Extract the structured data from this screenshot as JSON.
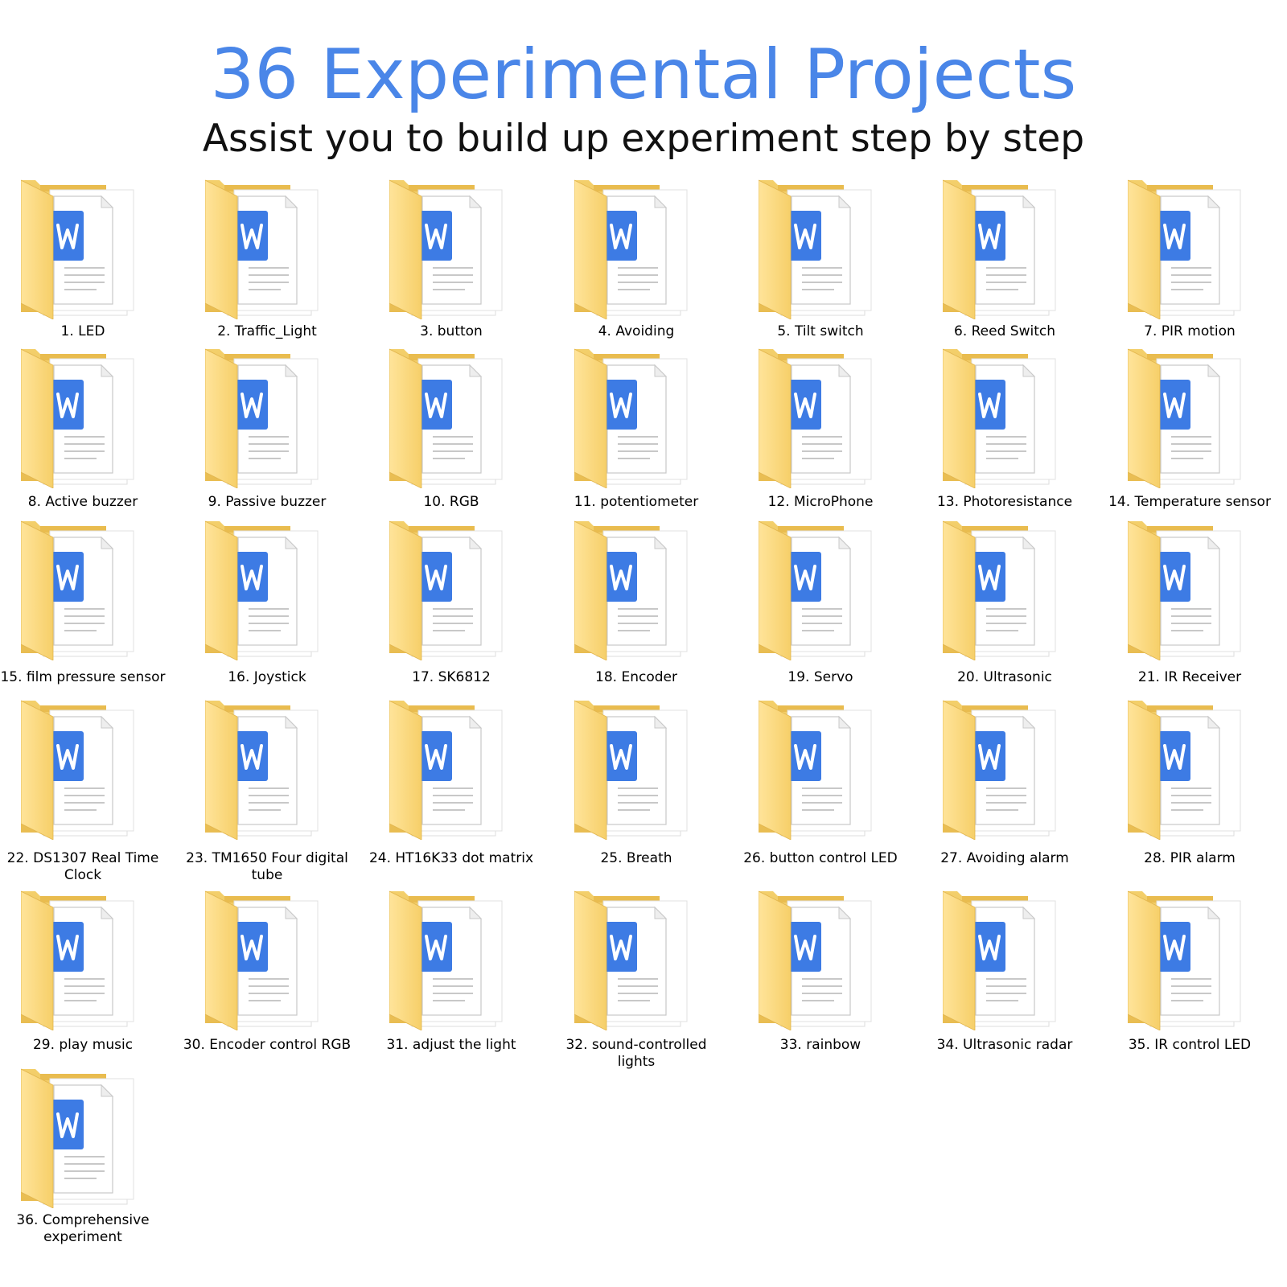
{
  "header": {
    "title": "36 Experimental Projects",
    "subtitle": "Assist you to build up experiment step by step"
  },
  "icon": "word-document-folder-icon",
  "colors": {
    "title": "#4a86e8",
    "folder": "#f8d775",
    "word_badge": "#3d7be4"
  },
  "projects": [
    {
      "label": "1. LED"
    },
    {
      "label": "2. Traffic_Light"
    },
    {
      "label": "3. button"
    },
    {
      "label": "4. Avoiding"
    },
    {
      "label": "5. Tilt switch"
    },
    {
      "label": "6. Reed Switch"
    },
    {
      "label": "7. PIR motion"
    },
    {
      "label": "8. Active buzzer"
    },
    {
      "label": "9. Passive buzzer"
    },
    {
      "label": "10. RGB"
    },
    {
      "label": "11. potentiometer"
    },
    {
      "label": "12. MicroPhone"
    },
    {
      "label": "13. Photoresistance"
    },
    {
      "label": "14. Temperature sensor"
    },
    {
      "label": "15. film pressure sensor"
    },
    {
      "label": "16. Joystick"
    },
    {
      "label": "17. SK6812"
    },
    {
      "label": "18. Encoder"
    },
    {
      "label": "19. Servo"
    },
    {
      "label": "20. Ultrasonic"
    },
    {
      "label": "21. IR Receiver"
    },
    {
      "label": "22. DS1307 Real Time Clock"
    },
    {
      "label": "23. TM1650 Four digital tube"
    },
    {
      "label": "24. HT16K33 dot matrix"
    },
    {
      "label": "25. Breath"
    },
    {
      "label": "26. button control LED"
    },
    {
      "label": "27. Avoiding alarm"
    },
    {
      "label": "28. PIR alarm"
    },
    {
      "label": "29. play music"
    },
    {
      "label": "30. Encoder control RGB"
    },
    {
      "label": "31. adjust the light"
    },
    {
      "label": "32. sound-controlled lights"
    },
    {
      "label": "33. rainbow"
    },
    {
      "label": "34. Ultrasonic radar"
    },
    {
      "label": "35. IR control LED"
    },
    {
      "label": "36. Comprehensive experiment"
    }
  ]
}
